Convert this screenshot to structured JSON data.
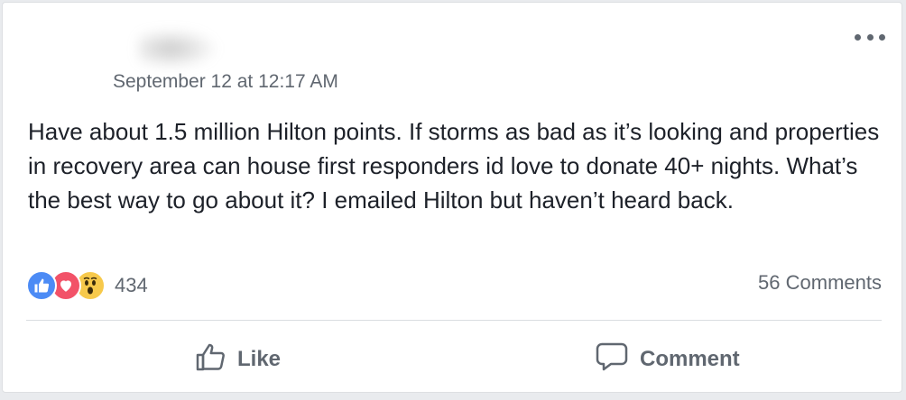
{
  "post": {
    "timestamp": "September 12 at 12:17 AM",
    "text": "Have about 1.5 million Hilton points. If storms as bad as it’s looking and properties in recovery area can house first responders id love to donate 40+ nights. What’s the best way to go about it? I emailed Hilton but haven’t heard back."
  },
  "reactions": {
    "icons": [
      "like-icon",
      "love-icon",
      "wow-icon"
    ],
    "count": "434"
  },
  "comments": {
    "count_label": "56 Comments"
  },
  "actions": {
    "like_label": "Like",
    "comment_label": "Comment"
  },
  "colors": {
    "like_blue": "#4c8bf5",
    "love_red": "#f25268",
    "wow_yellow": "#f7c94b",
    "secondary_text": "#606770"
  }
}
